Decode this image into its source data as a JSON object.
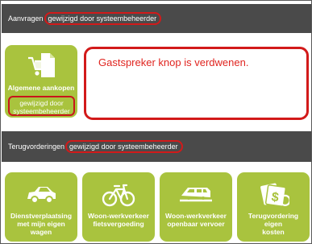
{
  "section1": {
    "label": "Aanvragen",
    "changed": "gewijzigd door systeembeheerder"
  },
  "main_tile": {
    "label": "Algemene aankopen",
    "sub_line1": "gewijzigd door",
    "sub_line2": "systeembeheerder",
    "icon": "cart-document-icon"
  },
  "callout": {
    "text": "Gastspreker knop is verdwenen."
  },
  "section2": {
    "label": "Terugvorderingen",
    "changed": "gewijzigd door systeembeheerder"
  },
  "tiles": [
    {
      "line1": "Dienstverplaatsing",
      "line2": "met mijn eigen",
      "line3": "wagen",
      "icon": "car-icon"
    },
    {
      "line1": "Woon-werkverkeer",
      "line2": "fietsvergoeding",
      "line3": "",
      "icon": "bicycle-icon"
    },
    {
      "line1": "Woon-werkverkeer",
      "line2": "openbaar vervoer",
      "line3": "",
      "icon": "train-icon"
    },
    {
      "line1": "Terugvordering eigen",
      "line2": "kosten",
      "line3": "",
      "icon": "money-icon"
    }
  ],
  "colors": {
    "tile_green": "#a9c33e",
    "header_gray": "#4a4a4a",
    "highlight_red": "#d21a1a"
  }
}
